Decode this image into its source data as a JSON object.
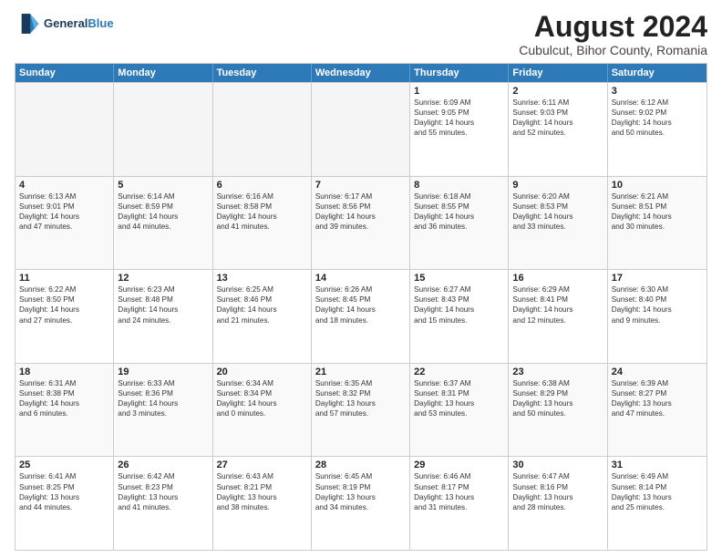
{
  "header": {
    "logo_line1": "General",
    "logo_line2": "Blue",
    "month": "August 2024",
    "location": "Cubulcut, Bihor County, Romania"
  },
  "days_of_week": [
    "Sunday",
    "Monday",
    "Tuesday",
    "Wednesday",
    "Thursday",
    "Friday",
    "Saturday"
  ],
  "weeks": [
    [
      {
        "day": "",
        "info": ""
      },
      {
        "day": "",
        "info": ""
      },
      {
        "day": "",
        "info": ""
      },
      {
        "day": "",
        "info": ""
      },
      {
        "day": "1",
        "info": "Sunrise: 6:09 AM\nSunset: 9:05 PM\nDaylight: 14 hours\nand 55 minutes."
      },
      {
        "day": "2",
        "info": "Sunrise: 6:11 AM\nSunset: 9:03 PM\nDaylight: 14 hours\nand 52 minutes."
      },
      {
        "day": "3",
        "info": "Sunrise: 6:12 AM\nSunset: 9:02 PM\nDaylight: 14 hours\nand 50 minutes."
      }
    ],
    [
      {
        "day": "4",
        "info": "Sunrise: 6:13 AM\nSunset: 9:01 PM\nDaylight: 14 hours\nand 47 minutes."
      },
      {
        "day": "5",
        "info": "Sunrise: 6:14 AM\nSunset: 8:59 PM\nDaylight: 14 hours\nand 44 minutes."
      },
      {
        "day": "6",
        "info": "Sunrise: 6:16 AM\nSunset: 8:58 PM\nDaylight: 14 hours\nand 41 minutes."
      },
      {
        "day": "7",
        "info": "Sunrise: 6:17 AM\nSunset: 8:56 PM\nDaylight: 14 hours\nand 39 minutes."
      },
      {
        "day": "8",
        "info": "Sunrise: 6:18 AM\nSunset: 8:55 PM\nDaylight: 14 hours\nand 36 minutes."
      },
      {
        "day": "9",
        "info": "Sunrise: 6:20 AM\nSunset: 8:53 PM\nDaylight: 14 hours\nand 33 minutes."
      },
      {
        "day": "10",
        "info": "Sunrise: 6:21 AM\nSunset: 8:51 PM\nDaylight: 14 hours\nand 30 minutes."
      }
    ],
    [
      {
        "day": "11",
        "info": "Sunrise: 6:22 AM\nSunset: 8:50 PM\nDaylight: 14 hours\nand 27 minutes."
      },
      {
        "day": "12",
        "info": "Sunrise: 6:23 AM\nSunset: 8:48 PM\nDaylight: 14 hours\nand 24 minutes."
      },
      {
        "day": "13",
        "info": "Sunrise: 6:25 AM\nSunset: 8:46 PM\nDaylight: 14 hours\nand 21 minutes."
      },
      {
        "day": "14",
        "info": "Sunrise: 6:26 AM\nSunset: 8:45 PM\nDaylight: 14 hours\nand 18 minutes."
      },
      {
        "day": "15",
        "info": "Sunrise: 6:27 AM\nSunset: 8:43 PM\nDaylight: 14 hours\nand 15 minutes."
      },
      {
        "day": "16",
        "info": "Sunrise: 6:29 AM\nSunset: 8:41 PM\nDaylight: 14 hours\nand 12 minutes."
      },
      {
        "day": "17",
        "info": "Sunrise: 6:30 AM\nSunset: 8:40 PM\nDaylight: 14 hours\nand 9 minutes."
      }
    ],
    [
      {
        "day": "18",
        "info": "Sunrise: 6:31 AM\nSunset: 8:38 PM\nDaylight: 14 hours\nand 6 minutes."
      },
      {
        "day": "19",
        "info": "Sunrise: 6:33 AM\nSunset: 8:36 PM\nDaylight: 14 hours\nand 3 minutes."
      },
      {
        "day": "20",
        "info": "Sunrise: 6:34 AM\nSunset: 8:34 PM\nDaylight: 14 hours\nand 0 minutes."
      },
      {
        "day": "21",
        "info": "Sunrise: 6:35 AM\nSunset: 8:32 PM\nDaylight: 13 hours\nand 57 minutes."
      },
      {
        "day": "22",
        "info": "Sunrise: 6:37 AM\nSunset: 8:31 PM\nDaylight: 13 hours\nand 53 minutes."
      },
      {
        "day": "23",
        "info": "Sunrise: 6:38 AM\nSunset: 8:29 PM\nDaylight: 13 hours\nand 50 minutes."
      },
      {
        "day": "24",
        "info": "Sunrise: 6:39 AM\nSunset: 8:27 PM\nDaylight: 13 hours\nand 47 minutes."
      }
    ],
    [
      {
        "day": "25",
        "info": "Sunrise: 6:41 AM\nSunset: 8:25 PM\nDaylight: 13 hours\nand 44 minutes."
      },
      {
        "day": "26",
        "info": "Sunrise: 6:42 AM\nSunset: 8:23 PM\nDaylight: 13 hours\nand 41 minutes."
      },
      {
        "day": "27",
        "info": "Sunrise: 6:43 AM\nSunset: 8:21 PM\nDaylight: 13 hours\nand 38 minutes."
      },
      {
        "day": "28",
        "info": "Sunrise: 6:45 AM\nSunset: 8:19 PM\nDaylight: 13 hours\nand 34 minutes."
      },
      {
        "day": "29",
        "info": "Sunrise: 6:46 AM\nSunset: 8:17 PM\nDaylight: 13 hours\nand 31 minutes."
      },
      {
        "day": "30",
        "info": "Sunrise: 6:47 AM\nSunset: 8:16 PM\nDaylight: 13 hours\nand 28 minutes."
      },
      {
        "day": "31",
        "info": "Sunrise: 6:49 AM\nSunset: 8:14 PM\nDaylight: 13 hours\nand 25 minutes."
      }
    ]
  ]
}
